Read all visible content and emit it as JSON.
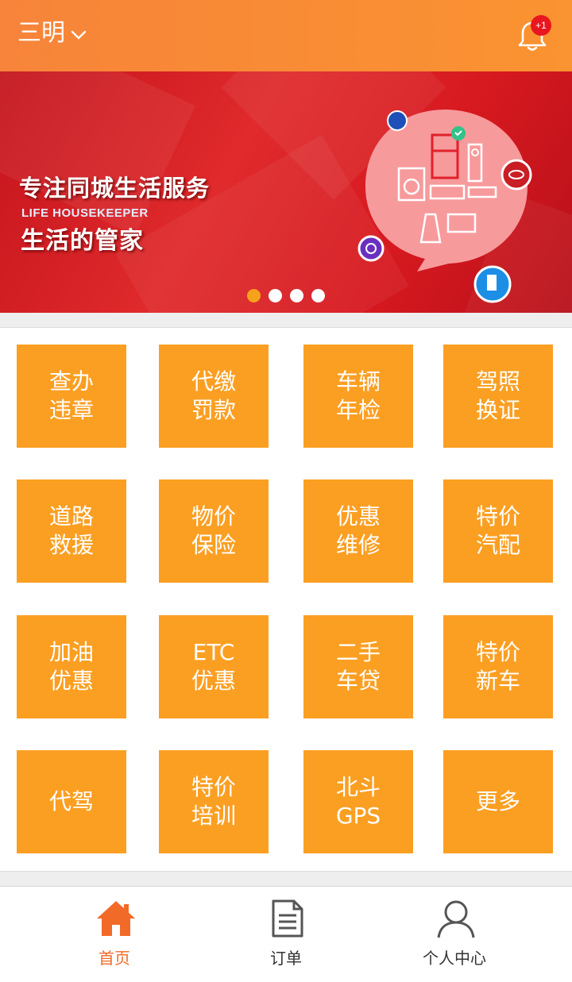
{
  "header": {
    "city": "三明",
    "notification_badge": "+1"
  },
  "banner": {
    "title": "专注同城生活服务",
    "subtitle_en": "LIFE HOUSEKEEPER",
    "slogan": "生活的管家",
    "carousel_pages": 4,
    "carousel_active_index": 0
  },
  "services": [
    {
      "label": "查办\n违章"
    },
    {
      "label": "代缴\n罚款"
    },
    {
      "label": "车辆\n年检"
    },
    {
      "label": "驾照\n换证"
    },
    {
      "label": "道路\n救援"
    },
    {
      "label": "物价\n保险"
    },
    {
      "label": "优惠\n维修"
    },
    {
      "label": "特价\n汽配"
    },
    {
      "label": "加油\n优惠"
    },
    {
      "label": "ETC\n优惠"
    },
    {
      "label": "二手\n车贷"
    },
    {
      "label": "特价\n新车"
    },
    {
      "label": "代驾"
    },
    {
      "label": "特价\n培训"
    },
    {
      "label": "北斗\nGPS"
    },
    {
      "label": "更多"
    }
  ],
  "bottom_nav": {
    "home": {
      "label": "首页",
      "icon": "home-icon",
      "active": true
    },
    "orders": {
      "label": "订单",
      "icon": "document-icon",
      "active": false
    },
    "profile": {
      "label": "个人中心",
      "icon": "user-icon",
      "active": false
    }
  },
  "colors": {
    "header_orange": "#f7843a",
    "tile_orange": "#fb9f22",
    "active_nav": "#f26a28",
    "banner_red": "#d6191f"
  }
}
